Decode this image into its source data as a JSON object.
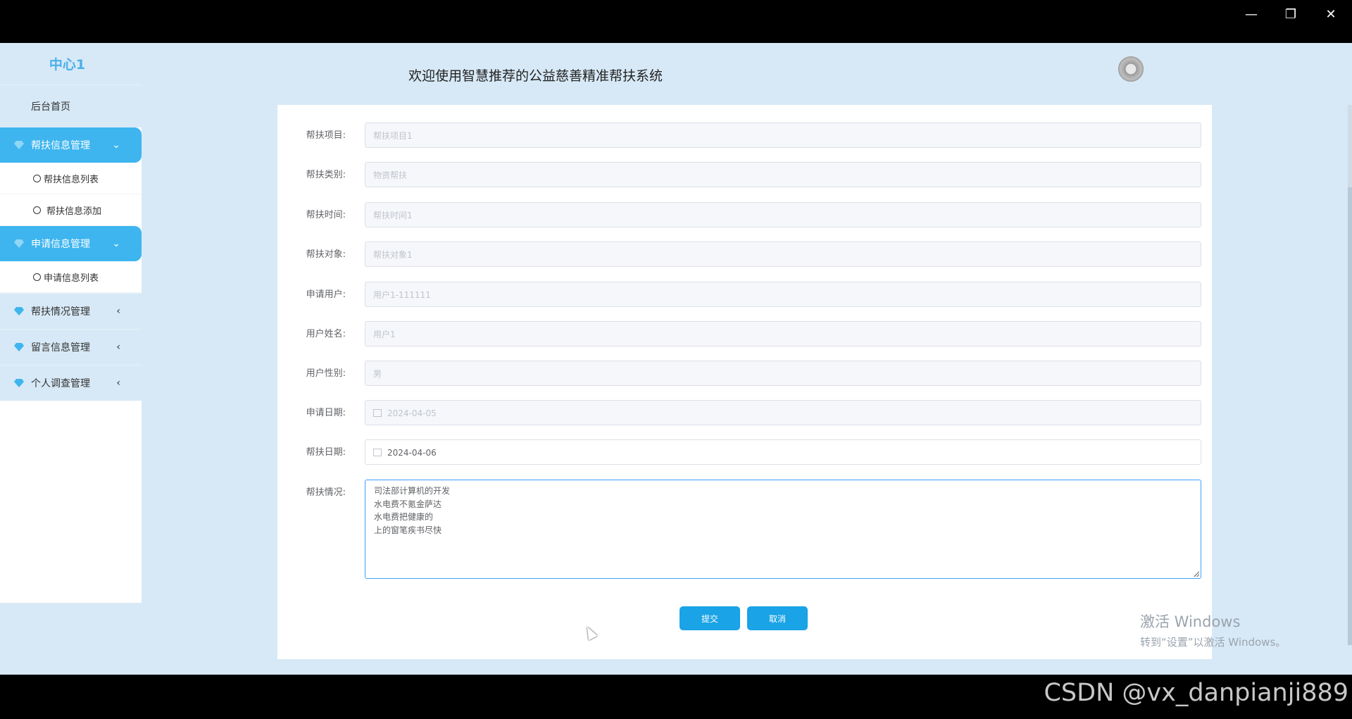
{
  "window": {
    "minimize_icon": "minimize-icon",
    "restore_icon": "restore-icon",
    "close_icon": "close-icon"
  },
  "sidebar": {
    "brand": "中心1",
    "home": "后台首页",
    "groups": [
      {
        "label": "帮扶信息管理",
        "expanded": true,
        "items": [
          "帮扶信息列表",
          "帮扶信息添加"
        ]
      },
      {
        "label": "申请信息管理",
        "expanded": true,
        "items": [
          "申请信息列表"
        ]
      },
      {
        "label": "帮扶情况管理",
        "expanded": false,
        "items": []
      },
      {
        "label": "留言信息管理",
        "expanded": false,
        "items": []
      },
      {
        "label": "个人调查管理",
        "expanded": false,
        "items": []
      }
    ]
  },
  "header": {
    "title": "欢迎使用智慧推荐的公益慈善精准帮扶系统"
  },
  "form": {
    "fields": [
      {
        "label": "帮扶项目:",
        "value": "帮扶项目1"
      },
      {
        "label": "帮扶类别:",
        "value": "物资帮扶"
      },
      {
        "label": "帮扶时间:",
        "value": "帮扶时间1"
      },
      {
        "label": "帮扶对象:",
        "value": "帮扶对象1"
      },
      {
        "label": "申请用户:",
        "value": "用户1-111111"
      },
      {
        "label": "用户姓名:",
        "value": "用户1"
      },
      {
        "label": "用户性别:",
        "value": "男"
      },
      {
        "label": "申请日期:",
        "value": "2024-04-05"
      },
      {
        "label": "帮扶日期:",
        "value": "2024-04-06"
      }
    ],
    "situation": {
      "label": "帮扶情况:",
      "lines": [
        "司法部计算机的开发",
        "水电费不氪金萨达",
        "水电费把健康的",
        "上的窗笔疾书尽快"
      ]
    },
    "submit_label": "提交",
    "cancel_label": "取消"
  },
  "overlay": {
    "activate_line1": "激活 Windows",
    "activate_line2": "转到“设置”以激活 Windows。",
    "csdn": "CSDN @vx_danpianji889"
  },
  "colors": {
    "accent": "#3eb5ef",
    "button": "#1aa3e6",
    "background": "#d7e9f6",
    "brand": "#4bb0ea"
  }
}
